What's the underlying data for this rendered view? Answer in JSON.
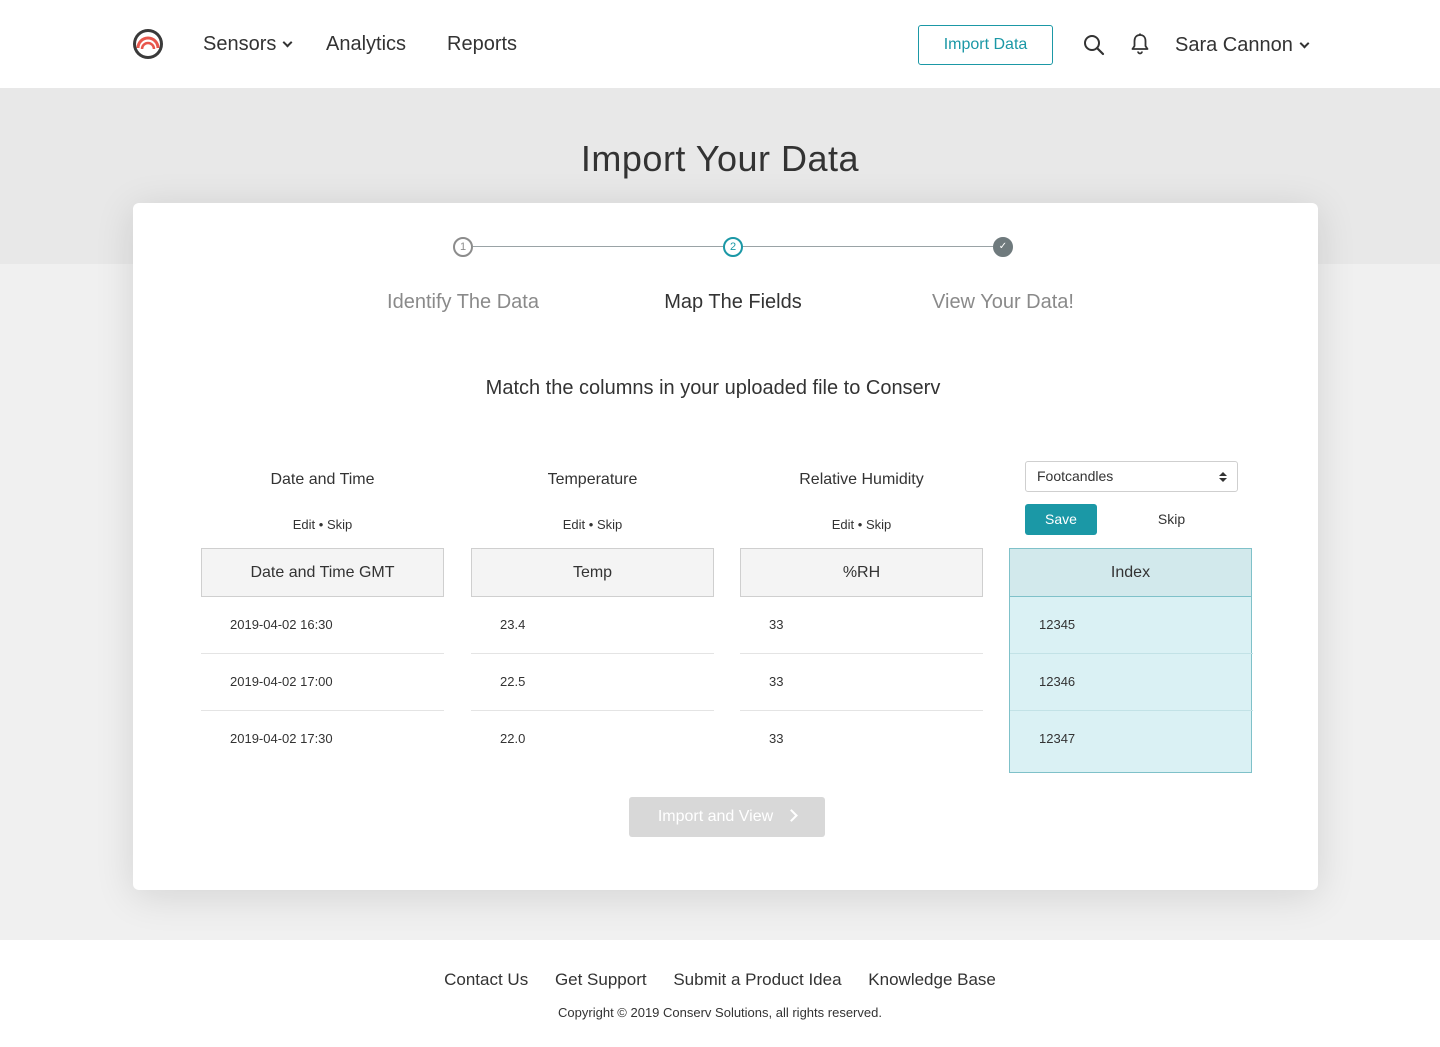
{
  "nav": {
    "logo_icon": "conserv-logo-icon",
    "sensors": "Sensors",
    "analytics": "Analytics",
    "reports": "Reports",
    "import_button": "Import Data",
    "user_name": "Sara Cannon"
  },
  "page": {
    "title": "Import Your Data",
    "instruction": "Match the columns in your uploaded file to Conserv"
  },
  "stepper": {
    "steps": [
      {
        "number": "1",
        "label": "Identify The Data",
        "state": "complete"
      },
      {
        "number": "2",
        "label": "Map The Fields",
        "state": "active"
      },
      {
        "number": "✓",
        "label": "View Your Data!",
        "state": "pending"
      }
    ]
  },
  "columns": [
    {
      "title": "Date and Time",
      "edit": "Edit",
      "separator": "•",
      "skip": "Skip",
      "header": "Date and Time GMT",
      "rows": [
        "2019-04-02 16:30",
        "2019-04-02 17:00",
        "2019-04-02 17:30"
      ]
    },
    {
      "title": "Temperature",
      "edit": "Edit",
      "separator": "•",
      "skip": "Skip",
      "header": "Temp",
      "rows": [
        "23.4",
        "22.5",
        "22.0"
      ]
    },
    {
      "title": "Relative Humidity",
      "edit": "Edit",
      "separator": "•",
      "skip": "Skip",
      "header": "%RH",
      "rows": [
        "33",
        "33",
        "33"
      ]
    },
    {
      "select_value": "Footcandles",
      "save": "Save",
      "skip": "Skip",
      "header": "Index",
      "rows": [
        "12345",
        "12346",
        "12347"
      ]
    }
  ],
  "import_view_button": "Import and View",
  "footer": {
    "links": [
      "Contact Us",
      "Get Support",
      "Submit a Product Idea",
      "Knowledge Base"
    ],
    "copyright": "Copyright © 2019 Conserv Solutions, all rights reserved."
  },
  "colors": {
    "accent": "#1b98a6",
    "active_column_bg": "#daf1f4",
    "disabled_button": "#d8d8d8"
  }
}
